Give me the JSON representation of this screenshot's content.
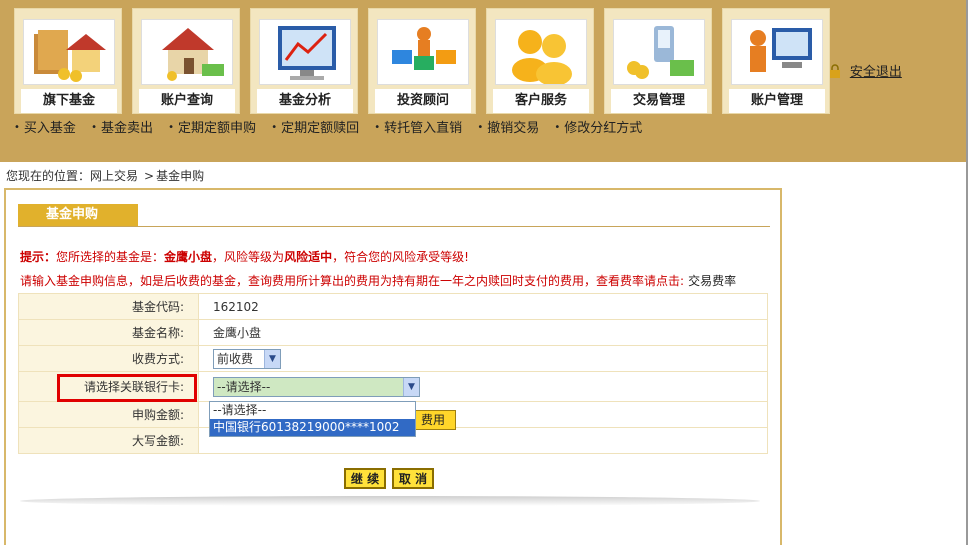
{
  "nav": {
    "tabs": [
      {
        "label": "旗下基金",
        "icon": "house-with-money-icon"
      },
      {
        "label": "账户查询",
        "icon": "house-icon"
      },
      {
        "label": "基金分析",
        "icon": "chart-monitor-icon"
      },
      {
        "label": "投资顾问",
        "icon": "advisor-blocks-icon"
      },
      {
        "label": "客户服务",
        "icon": "people-icon"
      },
      {
        "label": "交易管理",
        "icon": "phone-coins-icon"
      },
      {
        "label": "账户管理",
        "icon": "computer-user-icon"
      }
    ],
    "logout": "安全退出",
    "subnav": [
      "买入基金",
      "基金卖出",
      "定期定额申购",
      "定期定额赎回",
      "转托管入直销",
      "撤销交易",
      "修改分红方式"
    ]
  },
  "breadcrumb": {
    "prefix": "您现在的位置：网上交易",
    "sep": ">",
    "current": "基金申购"
  },
  "panel": {
    "title": "基金申购",
    "tip_label": "提示：",
    "tip_a": "您所选择的基金是：",
    "tip_fund": "金鹰小盘",
    "tip_b": "，风险等级为",
    "tip_risk": "风险适中",
    "tip_c": "，符合您的风险承受等级!",
    "info": "请输入基金申购信息，如是后收费的基金，查询费用所计算出的费用为持有期在一年之内赎回时支付的费用，查看费率请点击:",
    "info_link": "交易费率"
  },
  "form": {
    "fund_code_label": "基金代码:",
    "fund_code": "162102",
    "fund_name_label": "基金名称:",
    "fund_name": "金鹰小盘",
    "fee_label": "收费方式:",
    "fee_value": "前收费",
    "bank_label": "请选择关联银行卡:",
    "bank_value": "--请选择--",
    "bank_options": [
      "--请选择--",
      "中国银行60138219000****1002"
    ],
    "amount_label": "申购金额:",
    "fee_btn": "费用",
    "capital_label": "大写金额:"
  },
  "buttons": {
    "continue": "继 续",
    "cancel": "取 消"
  },
  "colors": {
    "header": "#c9a45a",
    "accent": "#e1b12c",
    "warning": "#cc0000",
    "highlight_box": "#e00000"
  }
}
